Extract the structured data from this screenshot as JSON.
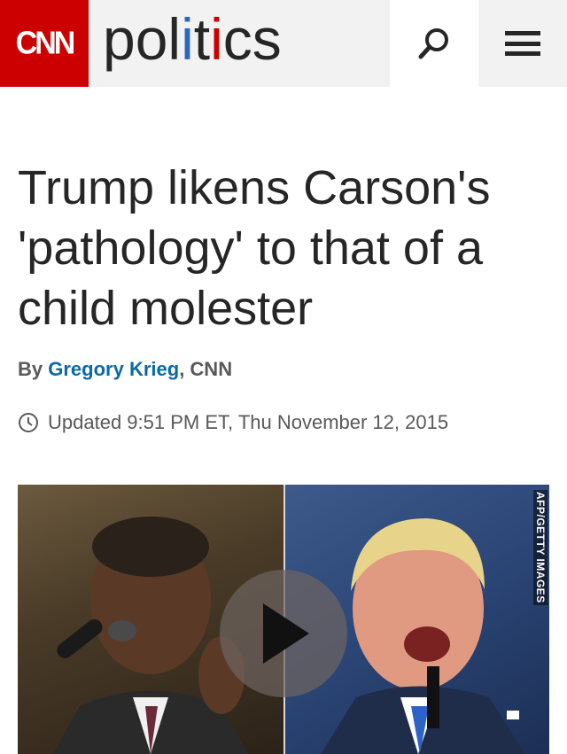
{
  "header": {
    "logo_text": "CNN",
    "section_parts": [
      "pol",
      "i",
      "t",
      "i",
      "cs"
    ],
    "icons": {
      "search": "search-icon",
      "menu": "hamburger-menu-icon"
    },
    "colors": {
      "brand_red": "#cc0000",
      "blue_i": "#2b67c1",
      "red_i": "#cc0000"
    }
  },
  "article": {
    "headline": "Trump likens Carson's 'pathology' to that of a child molester",
    "byline_prefix": "By ",
    "author": "Gregory Krieg",
    "byline_suffix": ", CNN",
    "timestamp": "Updated 9:51 PM ET, Thu November 12, 2015",
    "timestamp_icon": "clock-icon"
  },
  "video": {
    "credit": "AFP/GETTY IMAGES",
    "play_icon": "play-icon"
  }
}
